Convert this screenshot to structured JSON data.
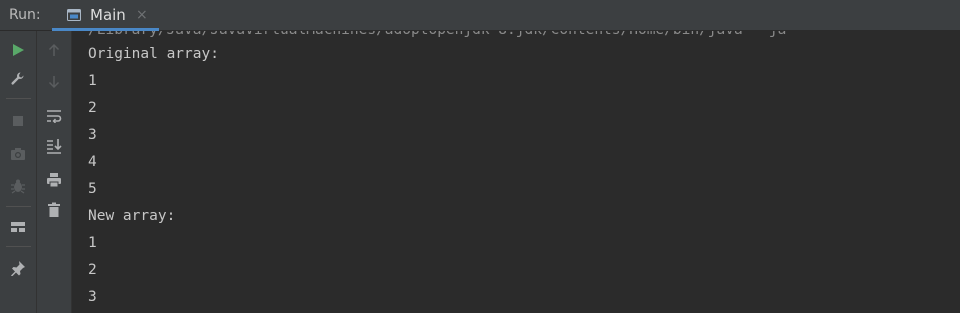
{
  "header": {
    "run_label": "Run:",
    "tab_label": "Main",
    "tab_close": "×"
  },
  "console": {
    "command_fragment": "/Library/Java/JavaVirtualMachines/adoptopenjdk-8.jdk/Contents/Home/bin/java \"-ja",
    "lines": [
      "Original array:",
      "1",
      "2",
      "3",
      "4",
      "5",
      "New array:",
      "1",
      "2",
      "3"
    ]
  },
  "colors": {
    "background": "#2b2b2b",
    "toolbar": "#3c3f41",
    "run_green": "#59a869",
    "tab_underline": "#4a88c7",
    "text": "#c7c7c7"
  },
  "icons": {
    "left_toolbar": [
      "run-icon",
      "wrench-icon",
      "stop-icon",
      "camera-icon",
      "debug-bug-icon",
      "layout-icon",
      "pin-icon"
    ],
    "right_toolbar": [
      "arrow-up-icon",
      "arrow-down-icon",
      "soft-wrap-icon",
      "scroll-to-end-icon",
      "print-icon",
      "trash-icon"
    ]
  }
}
